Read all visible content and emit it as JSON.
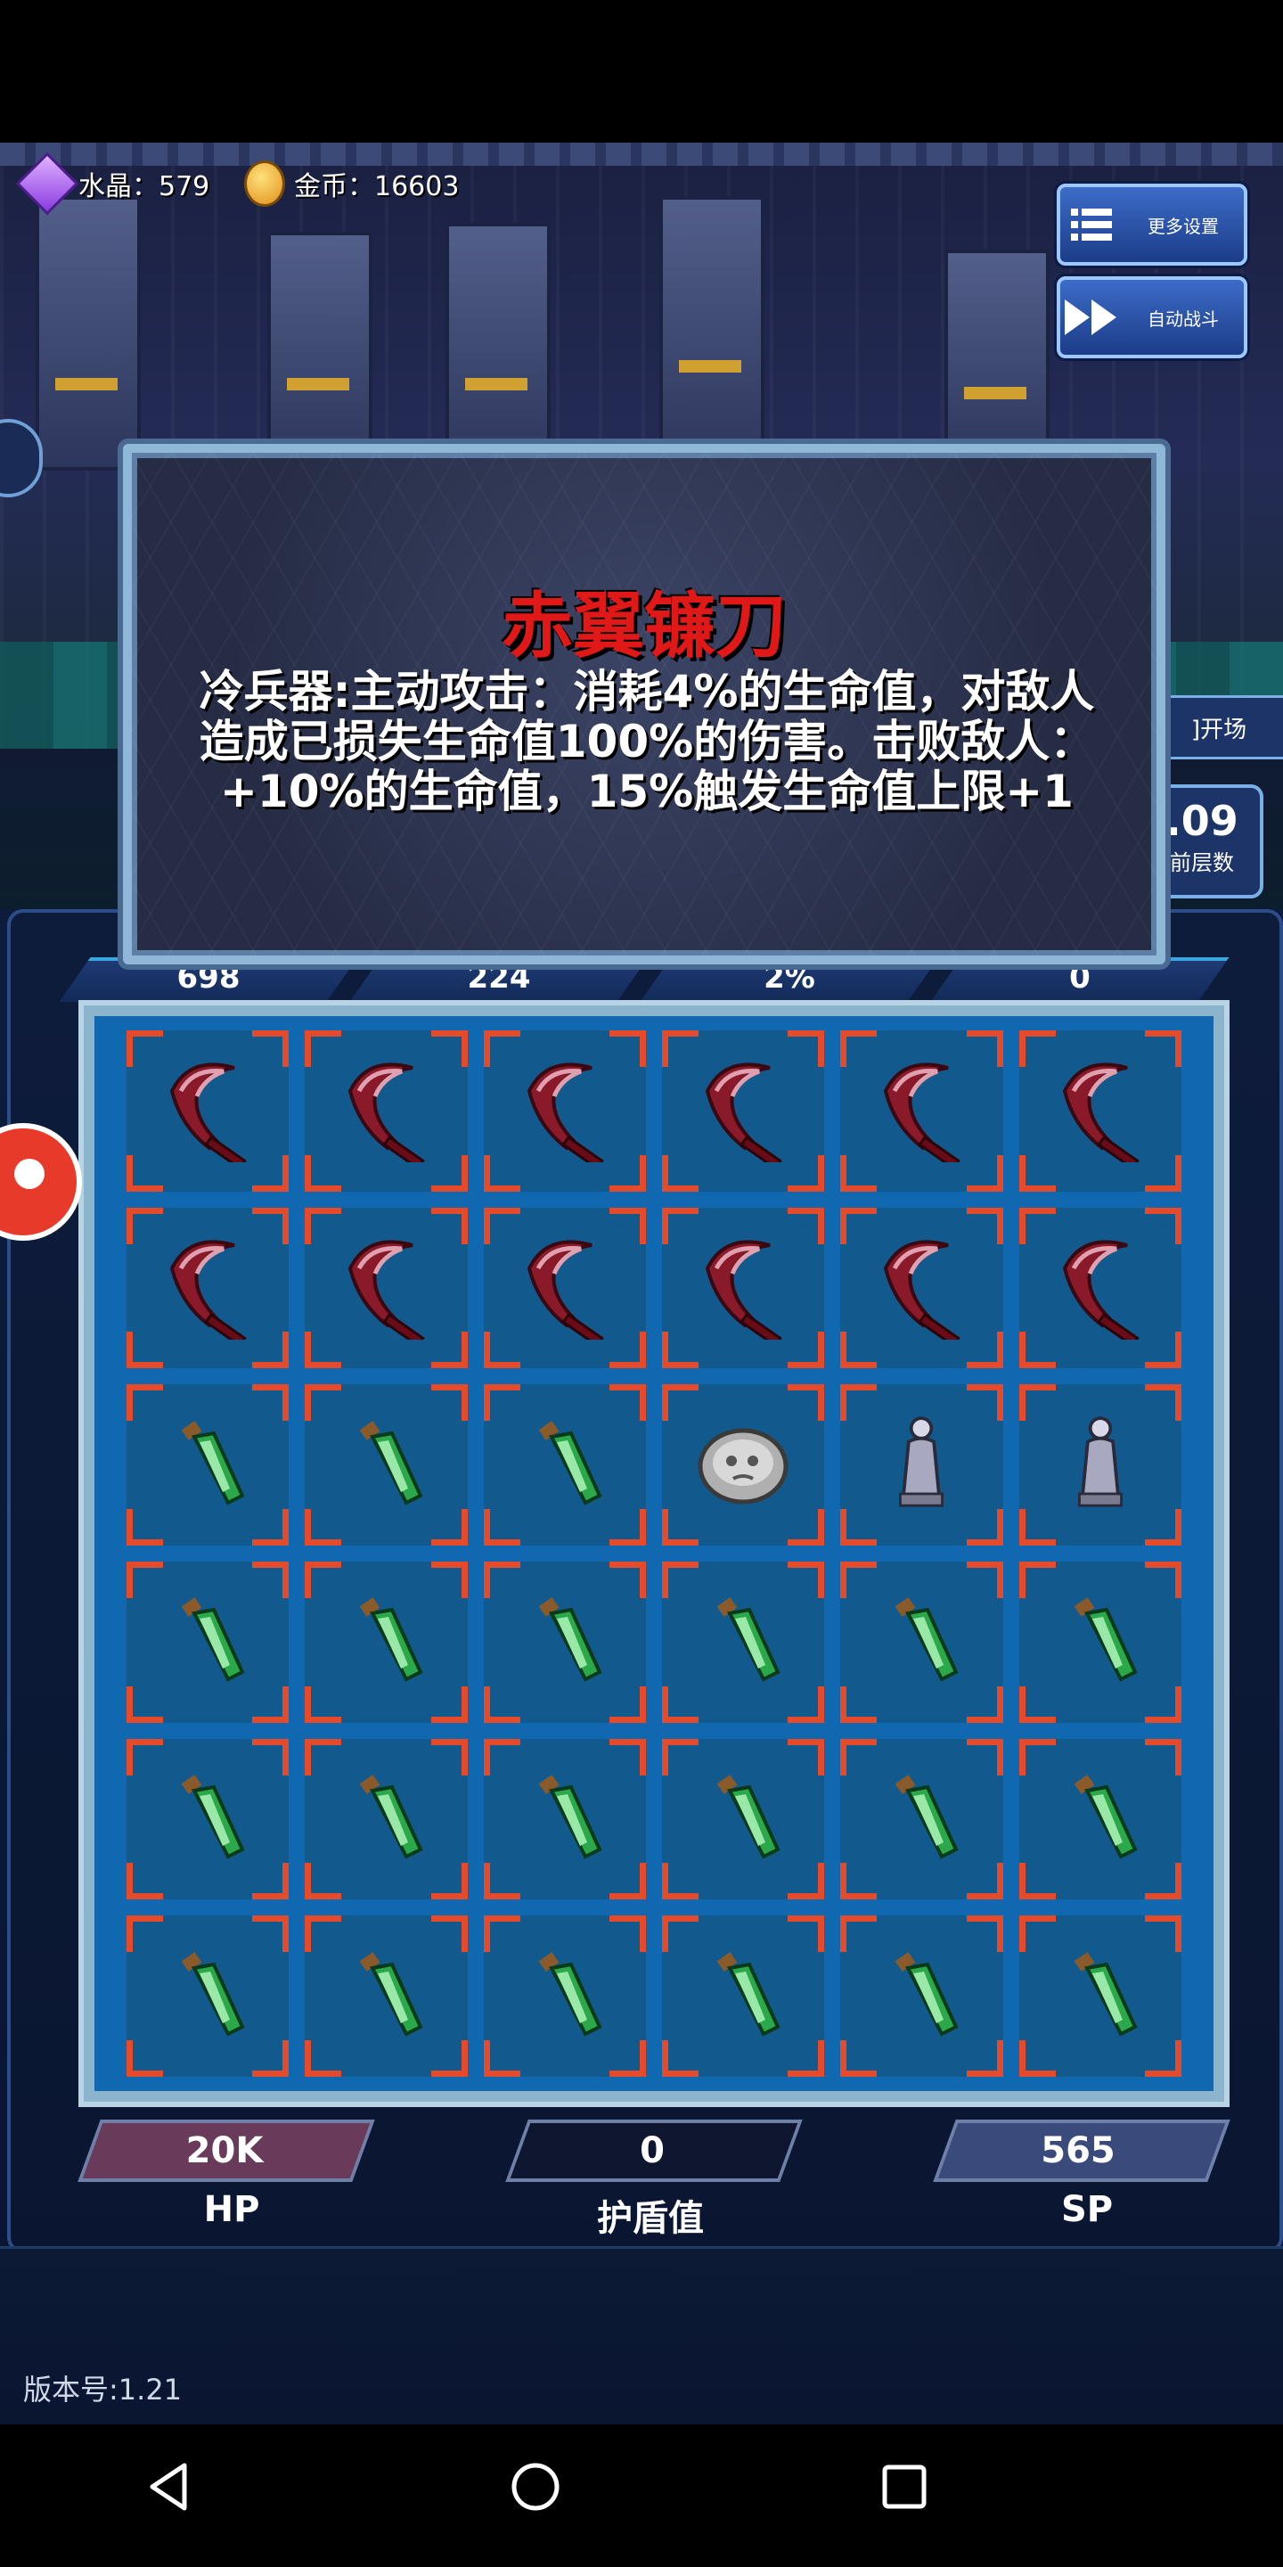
{
  "header": {
    "crystal_label": "水晶：579",
    "gold_label": "金币：16603",
    "more_settings": "更多设置",
    "auto_battle": "自动战斗",
    "opening_label": "]开场",
    "floor_value": ".09",
    "floor_label": "前层数"
  },
  "stats_top": [
    "698",
    "224",
    "2%",
    "0"
  ],
  "tooltip": {
    "title": "赤翼镰刀",
    "description": "冷兵器:主动攻击：消耗4%的生命值，对敌人造成已损失生命值100%的伤害。击败敌人：+10%的生命值，15%触发生命值上限+1"
  },
  "grid": [
    [
      "scythe",
      "scythe",
      "scythe",
      "scythe",
      "scythe",
      "scythe"
    ],
    [
      "scythe",
      "scythe",
      "scythe",
      "scythe",
      "scythe",
      "scythe"
    ],
    [
      "potion",
      "potion",
      "potion",
      "stone",
      "statue",
      "statue"
    ],
    [
      "potion",
      "potion",
      "potion",
      "potion",
      "potion",
      "potion"
    ],
    [
      "potion",
      "potion",
      "potion",
      "potion",
      "potion",
      "potion"
    ],
    [
      "potion",
      "potion",
      "potion",
      "potion",
      "potion",
      "potion"
    ]
  ],
  "bottom_stats": [
    {
      "value": "20K",
      "label": "HP"
    },
    {
      "value": "0",
      "label": "护盾值"
    },
    {
      "value": "565",
      "label": "SP"
    }
  ],
  "version": "版本号:1.21",
  "colors": {
    "title_red": "#e01818",
    "cell_bracket": "#e54a2a",
    "grid_blue": "#1068b0"
  }
}
